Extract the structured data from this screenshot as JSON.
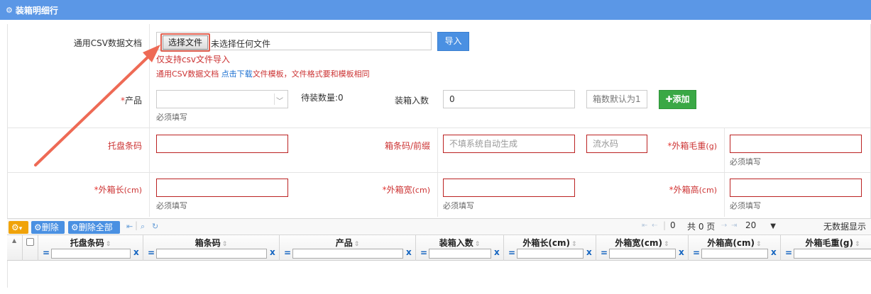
{
  "header": {
    "title": "装箱明细行",
    "icon": "gears-icon"
  },
  "import": {
    "label": "通用CSV数据文档",
    "file_button": "选择文件",
    "file_status": "未选择任何文件",
    "import_button": "导入",
    "note1": "仅支持csv文件导入",
    "note2_prefix": "通用CSV数据文档 ",
    "note2_link": "点击下载",
    "note2_suffix": "文件模板，文件格式要和模板相同"
  },
  "row1": {
    "product_label": "产品",
    "product_hint": "必须填写",
    "pending_label": "待装数量:0",
    "qty_label": "装箱入数",
    "qty_value": "0",
    "box_count_placeholder": "箱数默认为1",
    "add_button": "添加"
  },
  "row2": {
    "pallet_label": "托盘条码",
    "barcode_label": "箱条码/前缀",
    "barcode_placeholder": "不填系统自动生成",
    "serial_placeholder": "流水码",
    "gross_label": "外箱毛重",
    "gross_unit": "(g)",
    "gross_hint": "必须填写"
  },
  "row3": {
    "length_label": "外箱长",
    "length_unit": "(cm)",
    "length_hint": "必须填写",
    "width_label": "外箱宽",
    "width_unit": "(cm)",
    "width_hint": "必须填写",
    "height_label": "外箱高",
    "height_unit": "(cm)",
    "height_hint": "必须填写"
  },
  "toolbar": {
    "delete": "删除",
    "delete_all": "删除全部",
    "page_value": "0",
    "total_pages": "共 0 页",
    "page_size": "20",
    "no_data": "无数据显示"
  },
  "grid": {
    "columns": [
      "托盘条码",
      "箱条码",
      "产品",
      "装箱入数",
      "外箱长(cm)",
      "外箱宽(cm)",
      "外箱高(cm)",
      "外箱毛重(g)"
    ]
  },
  "colors": {
    "header": "#5b97e6",
    "primary": "#4a90e2",
    "success": "#3aa845",
    "error_border": "#b22222",
    "annotation_arrow": "#ee6a55"
  }
}
